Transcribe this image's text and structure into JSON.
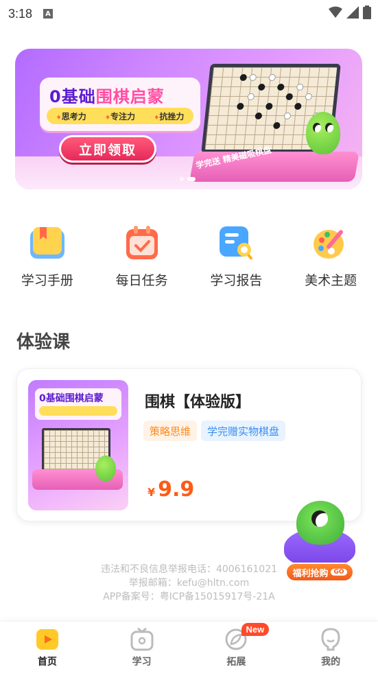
{
  "status_bar": {
    "time": "3:18",
    "notification_letter": "A"
  },
  "banner": {
    "title_prefix": "0基础",
    "title_highlight": "围棋启蒙",
    "tags": [
      "思考力",
      "专注力",
      "抗挫力"
    ],
    "button_label": "立即领取",
    "stand_text": "学完送 精美磁吸棋盘",
    "slide_count": 2,
    "active_slide": 1
  },
  "quick_menu": [
    {
      "label": "学习手册",
      "icon": "book-icon"
    },
    {
      "label": "每日任务",
      "icon": "calendar-check-icon"
    },
    {
      "label": "学习报告",
      "icon": "report-search-icon"
    },
    {
      "label": "美术主题",
      "icon": "palette-icon"
    }
  ],
  "trial": {
    "section_title": "体验课",
    "course": {
      "name": "围棋【体验版】",
      "tags": [
        "策略思维",
        "学完赠实物棋盘"
      ],
      "currency": "¥",
      "price": "9.9",
      "thumb_title": "0基础围棋启蒙"
    }
  },
  "footer": {
    "lines": [
      "违法和不良信息举报电话：4006161021",
      "举报邮箱：kefu@hltn.com",
      "APP备案号：粤ICP备15015917号-21A"
    ]
  },
  "welfare": {
    "label": "福利抢购",
    "go": "GO"
  },
  "tabbar": {
    "tabs": [
      {
        "label": "首页",
        "icon": "home-play-icon",
        "active": true
      },
      {
        "label": "学习",
        "icon": "study-tv-icon",
        "active": false
      },
      {
        "label": "拓展",
        "icon": "compass-leaf-icon",
        "active": false,
        "badge": "New"
      },
      {
        "label": "我的",
        "icon": "profile-face-icon",
        "active": false
      }
    ]
  },
  "colors": {
    "accent": "#ff5a14",
    "tab_active": "#ffc928",
    "banner_purple": "#b36bff",
    "tag_orange": "#ff8a1d",
    "tag_blue": "#3a8ef0"
  }
}
